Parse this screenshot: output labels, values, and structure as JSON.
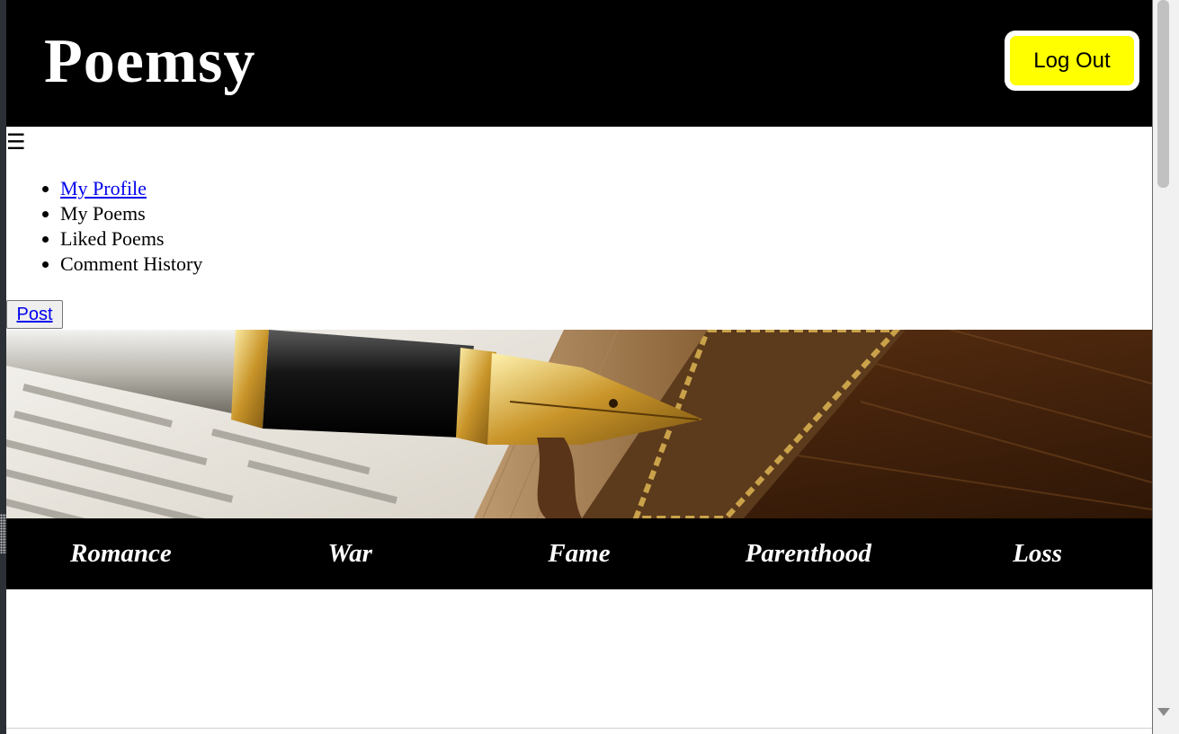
{
  "header": {
    "brand": "Poemsy",
    "logout_label": "Log Out"
  },
  "nav": {
    "toggle_glyph": "☰",
    "items": [
      {
        "label": "My Profile",
        "link": true
      },
      {
        "label": "My Poems",
        "link": false
      },
      {
        "label": "Liked Poems",
        "link": false
      },
      {
        "label": "Comment History",
        "link": false
      }
    ]
  },
  "post_button": {
    "label": "Post"
  },
  "genres": [
    "Romance",
    "War",
    "Fame",
    "Parenthood",
    "Loss"
  ],
  "colors": {
    "header_bg": "#000000",
    "logout_bg": "#ffff00",
    "link": "#0000ee"
  }
}
